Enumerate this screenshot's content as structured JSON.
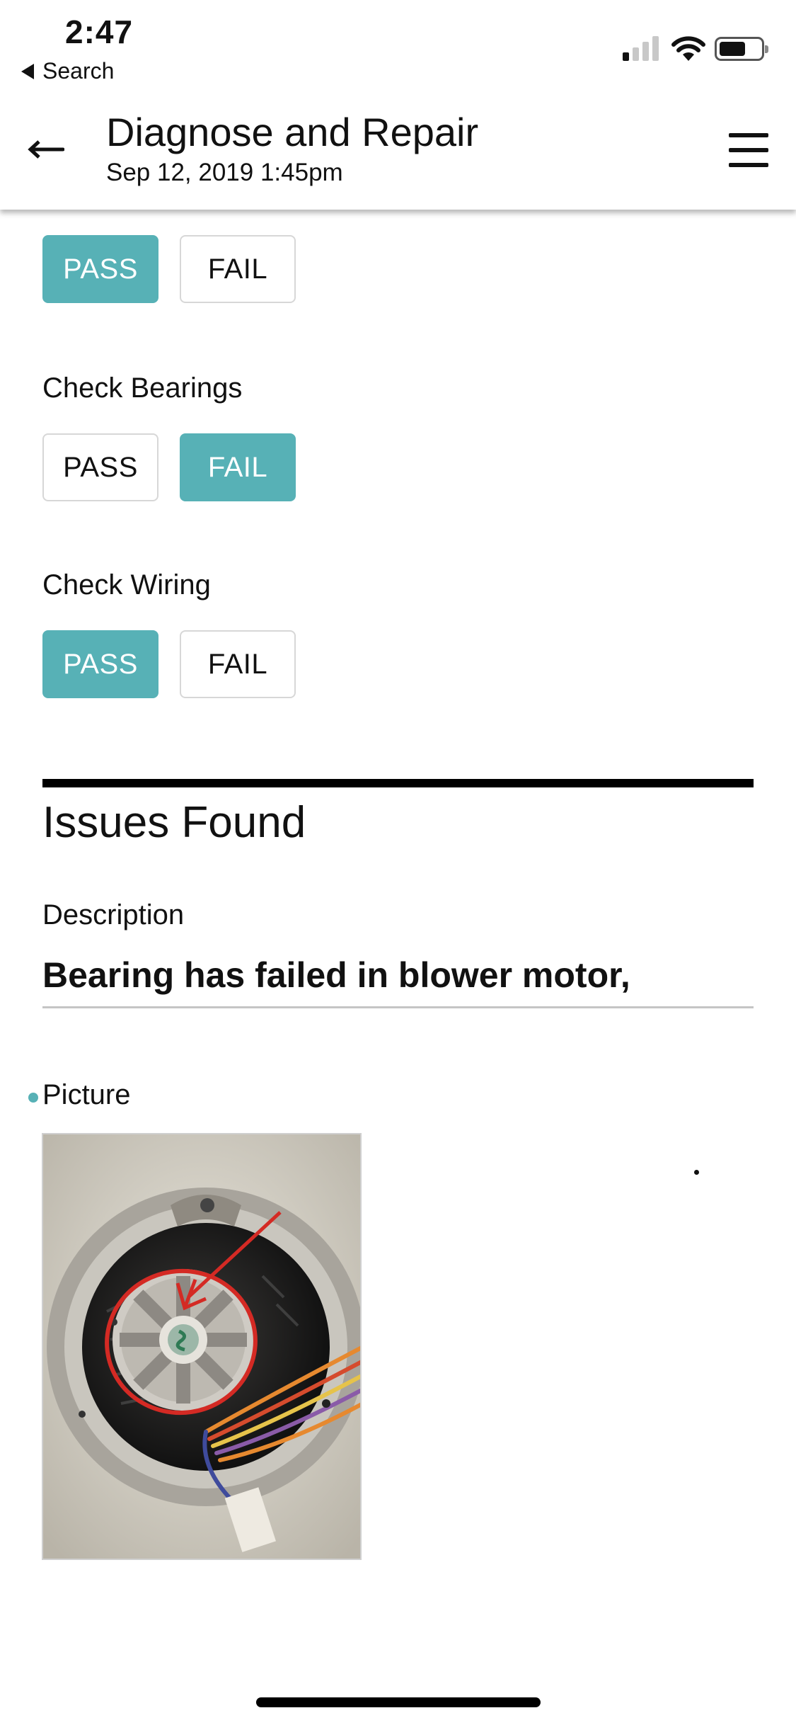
{
  "status_bar": {
    "time": "2:47",
    "back_app": "Search"
  },
  "header": {
    "title": "Diagnose and Repair",
    "subtitle": "Sep 12, 2019 1:45pm"
  },
  "checks": {
    "first": {
      "pass_label": "PASS",
      "fail_label": "FAIL",
      "selected": "PASS"
    },
    "bearings": {
      "label": "Check Bearings",
      "pass_label": "PASS",
      "fail_label": "FAIL",
      "selected": "FAIL"
    },
    "wiring": {
      "label": "Check Wiring",
      "pass_label": "PASS",
      "fail_label": "FAIL",
      "selected": "PASS"
    }
  },
  "issues": {
    "title": "Issues Found",
    "description_label": "Description",
    "description_value": "Bearing has failed in blower motor,",
    "picture_label": "Picture"
  },
  "colors": {
    "accent": "#57b1b6",
    "annotation_red": "#d42a24"
  },
  "icons": {
    "back": "left-arrow-icon",
    "menu": "hamburger-menu-icon"
  }
}
